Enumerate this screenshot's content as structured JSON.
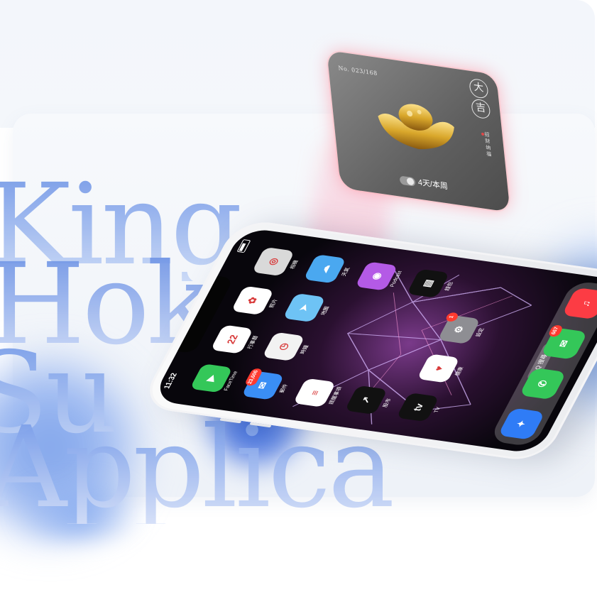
{
  "background": {
    "words": [
      "King",
      "Hok",
      "Su",
      "Applica"
    ]
  },
  "widget_card": {
    "number": "No. 023/168",
    "seal_chars": [
      "大",
      "吉"
    ],
    "vertical_text": "招 财 纳 福",
    "footer": "4天/本周",
    "colors": {
      "glow": "#ff7a8c",
      "card": "#5f5f5f",
      "gold": "#d9a72b"
    }
  },
  "phone": {
    "status": {
      "time": "11:32"
    },
    "apps": [
      {
        "label": "FaceTime",
        "icon": "facetime-icon",
        "color": "#34c759",
        "glyph": "▶"
      },
      {
        "label": "行事曆",
        "icon": "calendar-icon",
        "color": "#ffffff",
        "glyph": "22",
        "sub": "週六"
      },
      {
        "label": "照片",
        "icon": "photos-icon",
        "color": "#ffffff",
        "glyph": "✿"
      },
      {
        "label": "相機",
        "icon": "camera-icon",
        "color": "#d9d9d9",
        "glyph": "◎"
      },
      {
        "label": "郵件",
        "icon": "mail-icon",
        "color": "#3a8ef5",
        "glyph": "✉",
        "badge": "23,606"
      },
      {
        "label": "時鐘",
        "icon": "clock-icon",
        "color": "#f2f2f2",
        "glyph": "◷"
      },
      {
        "label": "地圖",
        "icon": "maps-icon",
        "color": "#6ec3f5",
        "glyph": "➤"
      },
      {
        "label": "天氣",
        "icon": "weather-icon",
        "color": "#4aa8f0",
        "glyph": "☁"
      },
      {
        "label": "提醒事項",
        "icon": "reminders-icon",
        "color": "#ffffff",
        "glyph": "≡"
      },
      {
        "label": "",
        "icon": "blank-slot",
        "color": "transparent",
        "glyph": ""
      },
      {
        "label": "",
        "icon": "blank-slot",
        "color": "transparent",
        "glyph": ""
      },
      {
        "label": "Podcast",
        "icon": "podcast-icon",
        "color": "#b45ae6",
        "glyph": "◉"
      },
      {
        "label": "股市",
        "icon": "stocks-icon",
        "color": "#111111",
        "glyph": "↗"
      },
      {
        "label": "",
        "icon": "blank-slot",
        "color": "transparent",
        "glyph": ""
      },
      {
        "label": "",
        "icon": "blank-slot",
        "color": "transparent",
        "glyph": ""
      },
      {
        "label": "錢包",
        "icon": "wallet-icon",
        "color": "#111111",
        "glyph": "▤"
      },
      {
        "label": "TV",
        "icon": "appletv-icon",
        "color": "#111111",
        "glyph": "tv"
      },
      {
        "label": "健康",
        "icon": "health-icon",
        "color": "#ffffff",
        "glyph": "♥"
      },
      {
        "label": "設定",
        "icon": "settings-icon",
        "color": "#8e8e93",
        "glyph": "⚙",
        "badge": "1"
      },
      {
        "label": "",
        "icon": "blank-slot",
        "color": "transparent",
        "glyph": ""
      }
    ],
    "search_label": "Q 搜尋",
    "dock": [
      {
        "icon": "safari-icon",
        "color": "#2f7cf6",
        "glyph": "✦"
      },
      {
        "icon": "phone-icon",
        "color": "#34c759",
        "glyph": "✆"
      },
      {
        "icon": "messages-icon",
        "color": "#34c759",
        "glyph": "✉",
        "badge": "667"
      },
      {
        "icon": "music-icon",
        "color": "#fc3c44",
        "glyph": "♫"
      }
    ]
  }
}
